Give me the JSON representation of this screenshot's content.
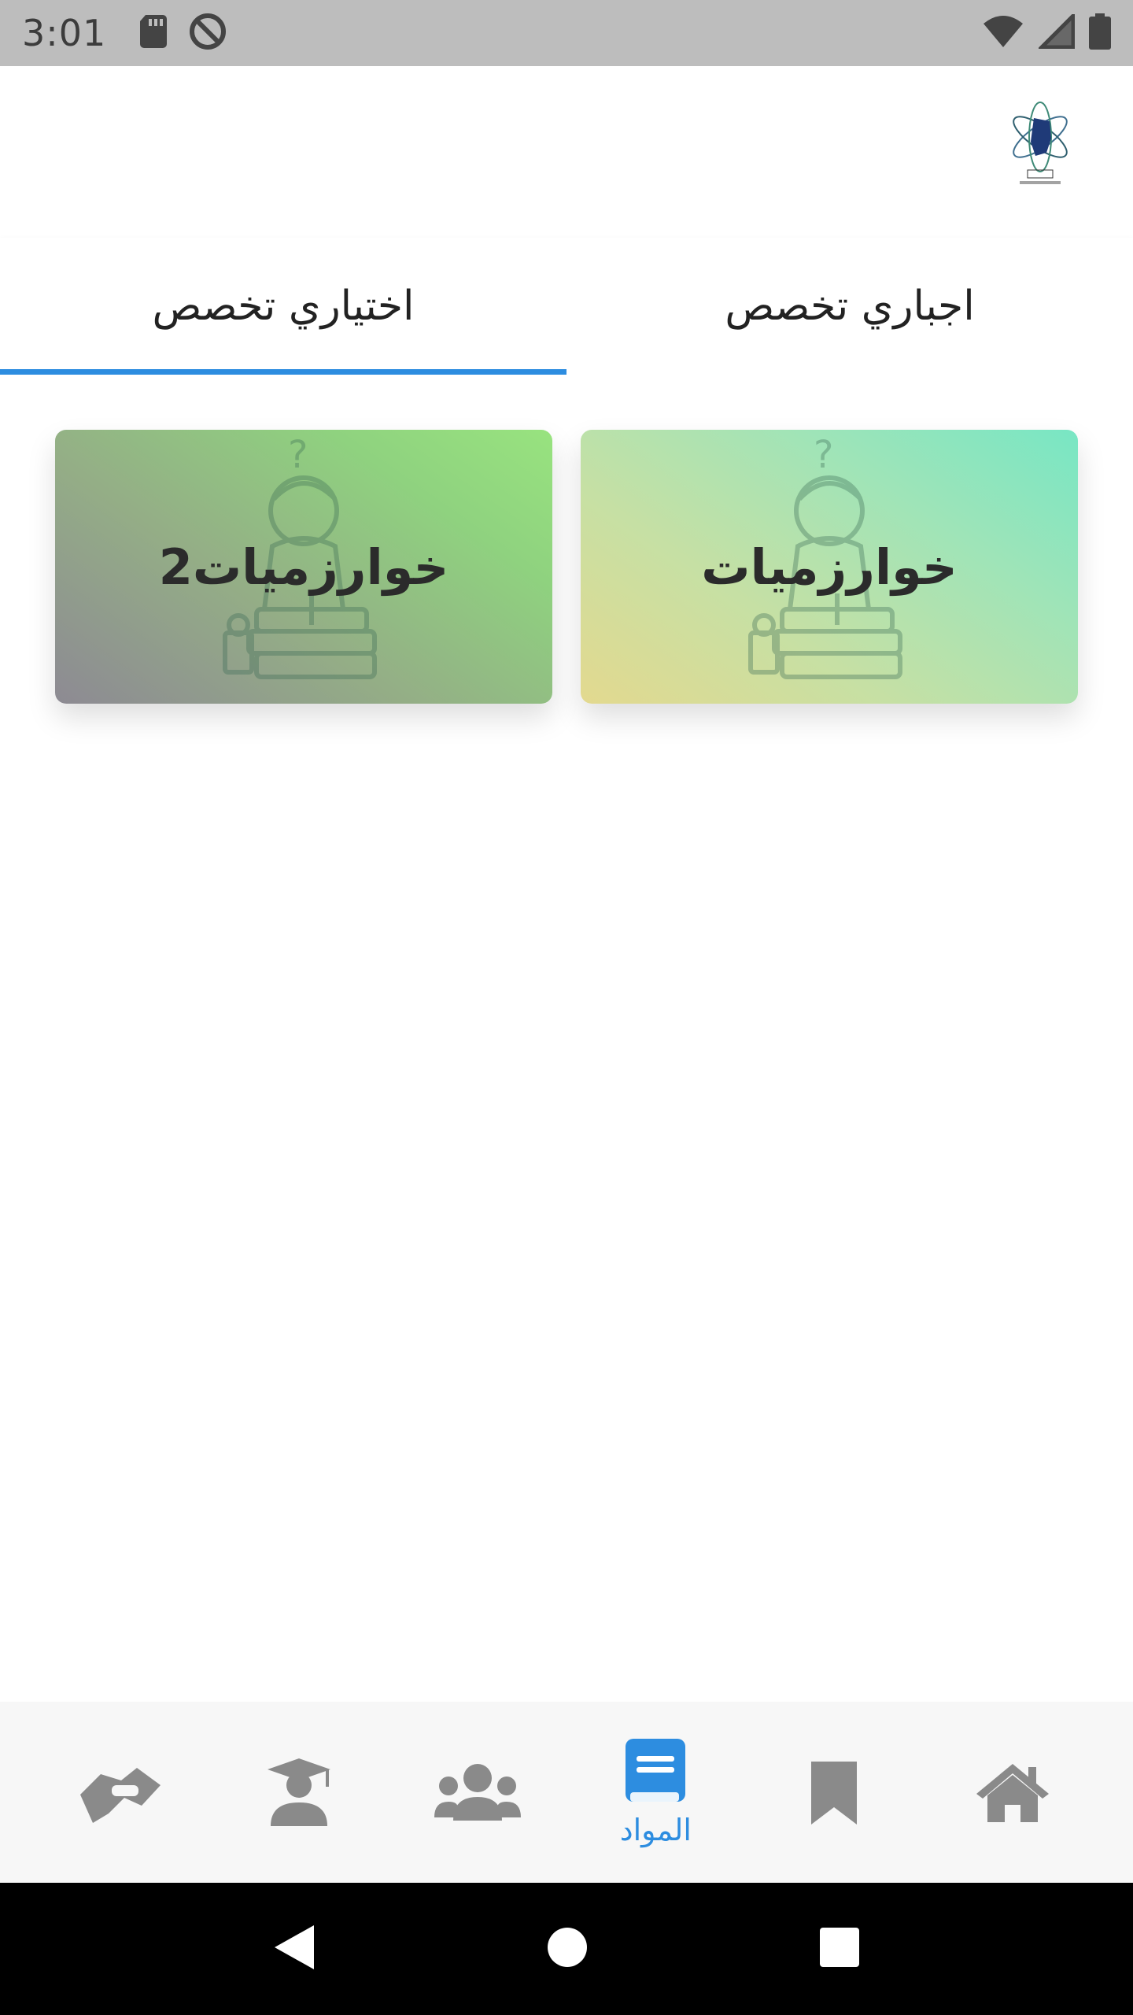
{
  "status_bar": {
    "time": "3:01",
    "left_icons": [
      "sd-card-icon",
      "do-not-disturb-icon"
    ],
    "right_icons": [
      "wifi-icon",
      "signal-icon",
      "battery-icon"
    ]
  },
  "tabs": [
    {
      "label": "اجباري تخصص",
      "active": false
    },
    {
      "label": "اختياري تخصص",
      "active": true
    }
  ],
  "cards": [
    {
      "title": "خوارزميات",
      "icon": "student-reading-illustration"
    },
    {
      "title": "خوارزميات2",
      "icon": "student-reading-illustration"
    }
  ],
  "bottom_nav": {
    "items": [
      {
        "icon": "home-icon",
        "label": ""
      },
      {
        "icon": "bookmark-icon",
        "label": ""
      },
      {
        "icon": "book-icon",
        "label": "المواد",
        "active": true
      },
      {
        "icon": "users-group-icon",
        "label": ""
      },
      {
        "icon": "graduate-icon",
        "label": ""
      },
      {
        "icon": "handshake-icon",
        "label": ""
      }
    ]
  },
  "colors": {
    "accent": "#2d8de0",
    "nav_icon": "#8a8a8a",
    "status_bar_bg": "#bdbdbd"
  },
  "system_nav": [
    "back-icon",
    "home-circle-icon",
    "recents-icon"
  ]
}
